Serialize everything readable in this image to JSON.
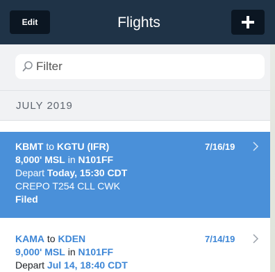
{
  "header": {
    "edit_label": "Edit",
    "title": "Flights"
  },
  "search": {
    "placeholder": "Filter"
  },
  "section": {
    "label": "JULY 2019"
  },
  "flights": [
    {
      "origin": "KBMT",
      "to_word": "to",
      "destination": "KGTU (IFR)",
      "date": "7/16/19",
      "altitude": "8,000' MSL",
      "in_word": "in",
      "aircraft": "N101FF",
      "depart_word": "Depart",
      "depart_time": "Today, 15:30 CDT",
      "route": "CREPO T254 CLL CWK",
      "status": "Filed"
    },
    {
      "origin": "KAMA",
      "to_word": "to",
      "destination": "KDEN",
      "date": "7/14/19",
      "altitude": "9,000' MSL",
      "in_word": "in",
      "aircraft": "N101FF",
      "depart_word": "Depart",
      "depart_time": "Jul 14, 18:40 CDT"
    }
  ],
  "colors": {
    "header_bg": "#1f3347",
    "selected_row": "#4a90d9",
    "accent_text": "#3d86d6"
  }
}
